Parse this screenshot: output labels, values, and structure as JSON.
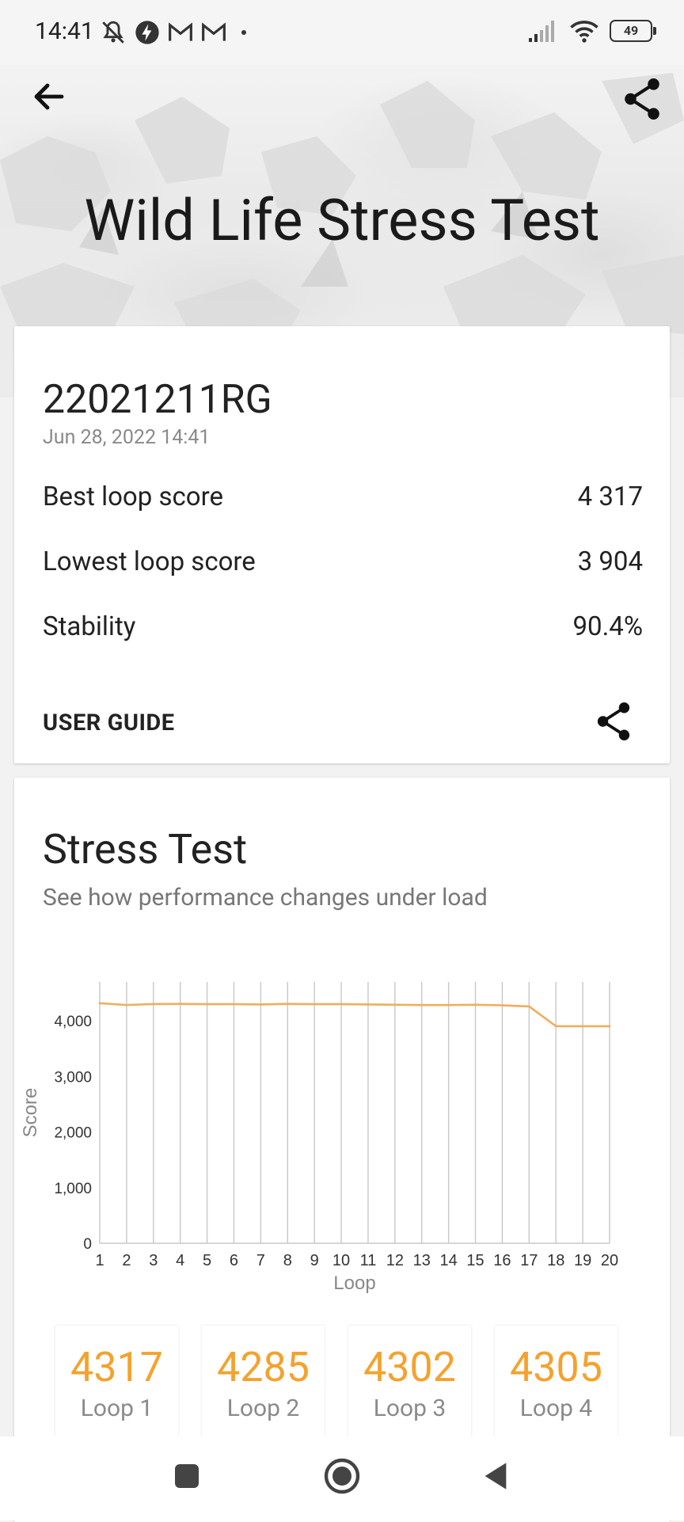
{
  "status_bar": {
    "time": "14:41",
    "battery": "49"
  },
  "hero": {
    "title": "Wild Life Stress Test"
  },
  "summary": {
    "device": "22021211RG",
    "date": "Jun 28, 2022 14:41",
    "rows": [
      {
        "label": "Best loop score",
        "value": "4 317"
      },
      {
        "label": "Lowest loop score",
        "value": "3 904"
      },
      {
        "label": "Stability",
        "value": "90.4%"
      }
    ],
    "user_guide": "USER GUIDE"
  },
  "stress": {
    "title": "Stress Test",
    "subtitle": "See how performance changes under load"
  },
  "chart_data": {
    "type": "line",
    "x": [
      1,
      2,
      3,
      4,
      5,
      6,
      7,
      8,
      9,
      10,
      11,
      12,
      13,
      14,
      15,
      16,
      17,
      18,
      19,
      20
    ],
    "series": [
      {
        "values": [
          4317,
          4285,
          4302,
          4305,
          4300,
          4300,
          4295,
          4305,
          4300,
          4300,
          4295,
          4290,
          4285,
          4285,
          4290,
          4280,
          4260,
          3904,
          3904,
          3904
        ]
      }
    ],
    "xlabel": "Loop",
    "ylabel": "Score",
    "ylim": [
      0,
      4700
    ],
    "yticks": [
      "0",
      "1,000",
      "2,000",
      "3,000",
      "4,000"
    ],
    "yticks_values": [
      0,
      1000,
      2000,
      3000,
      4000
    ],
    "grid": "vertical",
    "line_color": "#f0ad5c"
  },
  "loops": [
    {
      "score": "4317",
      "label": "Loop 1"
    },
    {
      "score": "4285",
      "label": "Loop 2"
    },
    {
      "score": "4302",
      "label": "Loop 3"
    },
    {
      "score": "4305",
      "label": "Loop 4"
    }
  ],
  "colors": {
    "accent": "#f4a22d"
  }
}
